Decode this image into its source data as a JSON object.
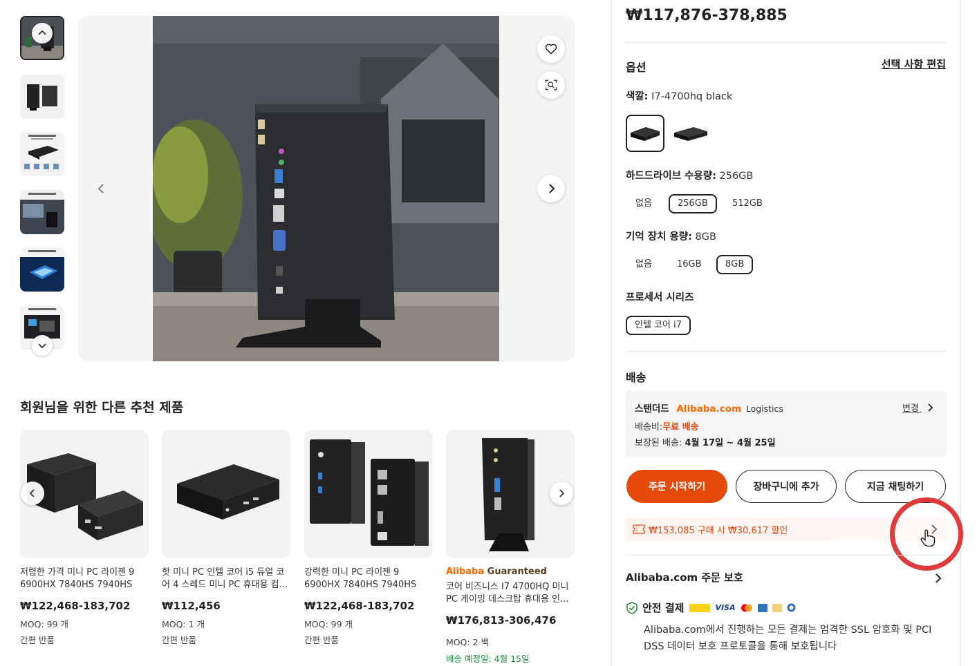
{
  "gallery": {
    "thumbnail_count": 6,
    "active_index": 0
  },
  "recommendations": {
    "title": "회원님을 위한 다른 추천 제품",
    "items": [
      {
        "title": "저렴한 가격 미니 PC 라이젠 9 6900HX 7840HS 7940HS 8...",
        "price": "₩122,468-183,702",
        "moq": "MOQ: 99 개",
        "returns": "간편 반품"
      },
      {
        "title": "핫 미니 PC 인텔 코어 i5 듀얼 코어 4 스레드 미니 PC 휴대용 컴...",
        "price": "₩112,456",
        "moq": "MOQ: 1 개",
        "returns": "간편 반품"
      },
      {
        "title": "강력한 미니 PC 라이젠 9 6900HX 7840HS 7940HS 2...",
        "price": "₩122,468-183,702",
        "moq": "MOQ: 99 개",
        "returns": "간편 반품"
      },
      {
        "badge_alibaba": "Alibaba",
        "badge_guaranteed": "Guaranteed",
        "title": "코어 비즈니스 I7 4700HQ 미니 PC 게이밍 데스크탑 휴대용 인...",
        "price": "₩176,813-306,476",
        "moq": "MOQ: 2 백",
        "delivery": "배송 예정일: 4월 15일"
      }
    ]
  },
  "product": {
    "price_range": "₩117,876-378,885",
    "options_title": "옵션",
    "edit_selection": "선택 사항 편집",
    "color": {
      "label": "색깔:",
      "value": "I7-4700hq black"
    },
    "hdd": {
      "label": "하드드라이브 수용량:",
      "value": "256GB",
      "choices": [
        "없음",
        "256GB",
        "512GB"
      ],
      "selected": 1
    },
    "memory": {
      "label": "기억 장치 용량:",
      "value": "8GB",
      "choices": [
        "없음",
        "16GB",
        "8GB"
      ],
      "selected": 2
    },
    "cpu": {
      "label": "프로세서 시리즈",
      "choices": [
        "인텔 코어 i7"
      ],
      "selected": 0
    }
  },
  "shipping": {
    "title": "배송",
    "method": "스탠더드",
    "provider_brand": "Alibaba.com",
    "provider_suffix": "Logistics",
    "change": "변경",
    "fee_label": "배송비:",
    "fee_value": "무료 배송",
    "guaranteed_label": "보장된 배송:",
    "guaranteed_value": "4월 17일 ~ 4월 25일"
  },
  "actions": {
    "order": "주문 시작하기",
    "cart": "장바구니에 추가",
    "chat": "지금 채팅하기"
  },
  "coupon": {
    "text": "₩153,085 구매 시 ₩30,617 할인"
  },
  "protection": {
    "title": "Alibaba.com 주문 보호",
    "safe_payment": "안전 결제",
    "description": "Alibaba.com에서 진행하는 모든 결제는 엄격한 SSL 암호화 및 PCI DSS 데이터 보호 프로토콜을 통해 보호됩니다"
  },
  "colors": {
    "accent": "#e64a0a",
    "alibaba_orange": "#ff6a00",
    "annotation_red": "#e03a3a",
    "green": "#1a8a3a"
  }
}
